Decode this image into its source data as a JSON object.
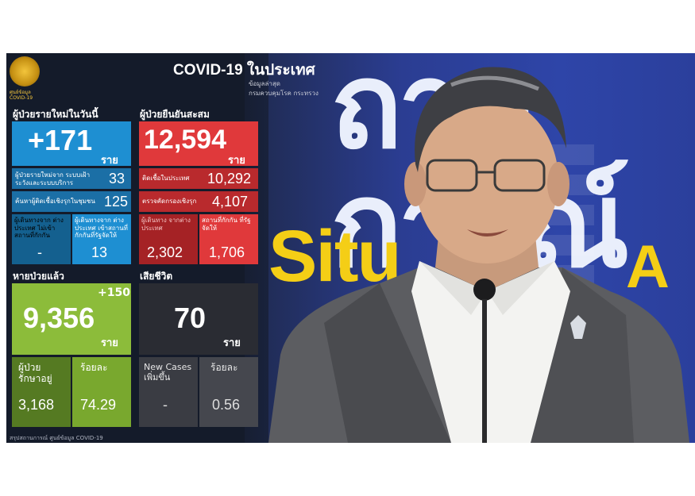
{
  "header": {
    "org_label": "ศูนย์ข้อมูล COVID-19",
    "headline": "COVID-19 ในประเทศ",
    "subline_1": "ข้อมูลล่าสุด",
    "subline_2": "กรมควบคุมโรค กระทรวง"
  },
  "new_cases": {
    "title": "ผู้ป่วยรายใหม่ในวันนี้",
    "value": "+171",
    "unit": "ราย",
    "rows": [
      {
        "label": "ผู้ป่วยรายใหม่จาก ระบบเฝ้าระวังและระบบบริการ",
        "value": "33"
      },
      {
        "label": "ค้นหาผู้ติดเชื้อเชิงรุกในชุมชน",
        "value": "125"
      }
    ],
    "cells": [
      {
        "label": "ผู้เดินทางจาก ต่างประเทศ ไม่เข้าสถานที่กักกัน",
        "value": "-"
      },
      {
        "label": "ผู้เดินทางจาก ต่างประเทศ เข้าสถานที่กักกันที่รัฐจัดให้",
        "value": "13"
      }
    ]
  },
  "cumulative": {
    "title": "ผู้ป่วยยืนยันสะสม",
    "value": "12,594",
    "unit": "ราย",
    "rows": [
      {
        "label": "ติดเชื้อในประเทศ",
        "value": "10,292"
      },
      {
        "label": "ตรวจคัดกรองเชิงรุก",
        "value": "4,107"
      }
    ],
    "cells": [
      {
        "label": "ผู้เดินทาง จากต่างประเทศ",
        "value": "2,302"
      },
      {
        "label": "สถานที่กักกัน ที่รัฐจัดให้",
        "value": "1,706"
      }
    ]
  },
  "recovered": {
    "title": "หายป่วยแล้ว",
    "delta": "+150",
    "value": "9,356",
    "unit": "ราย",
    "cells": [
      {
        "label": "ผู้ป่วย รักษาอยู่",
        "value": "3,168"
      },
      {
        "label": "ร้อยละ",
        "value": "74.29"
      }
    ]
  },
  "deaths": {
    "title": "เสียชีวิต",
    "value": "70",
    "unit": "ราย",
    "cells": [
      {
        "label": "New Cases เพิ่มขึ้น",
        "value": "-"
      },
      {
        "label": "ร้อยละ",
        "value": "0.56"
      }
    ]
  },
  "footer": "สรุปสถานการณ์ ศูนย์ข้อมูล COVID-19",
  "backdrop": {
    "thai_text": "ถานการณ์",
    "situ_text": "Situ",
    "a_text": "A"
  },
  "colors": {
    "blue": "#1e8fd2",
    "red": "#e0393b",
    "green": "#8cbc3a",
    "dark": "#2a2c33",
    "yellow": "#f4ce16"
  }
}
